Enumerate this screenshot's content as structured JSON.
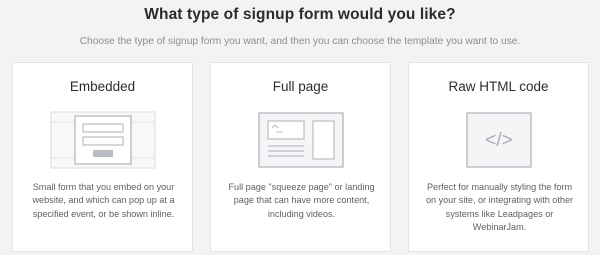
{
  "header": {
    "title": "What type of signup form would you like?",
    "subtitle": "Choose the type of signup form you want, and then you can choose the template you want to use."
  },
  "cards": [
    {
      "title": "Embedded",
      "icon": "embedded-form-icon",
      "description": "Small form that you embed on your website, and which can pop up at a specified event, or be shown inline."
    },
    {
      "title": "Full page",
      "icon": "full-page-form-icon",
      "description": "Full page \"squeeze page\" or landing page that can have more content, including videos."
    },
    {
      "title": "Raw HTML code",
      "icon": "code-icon",
      "code_glyph": "</>",
      "description": "Perfect for manually styling the form on your site, or integrating with other systems like Leadpages or WebinarJam."
    }
  ],
  "colors": {
    "background": "#f3f3f3",
    "card": "#ffffff",
    "card_border": "#e4e4e4",
    "illustration_stroke": "#b9bcc1",
    "illustration_fill": "#f4f5f7"
  }
}
